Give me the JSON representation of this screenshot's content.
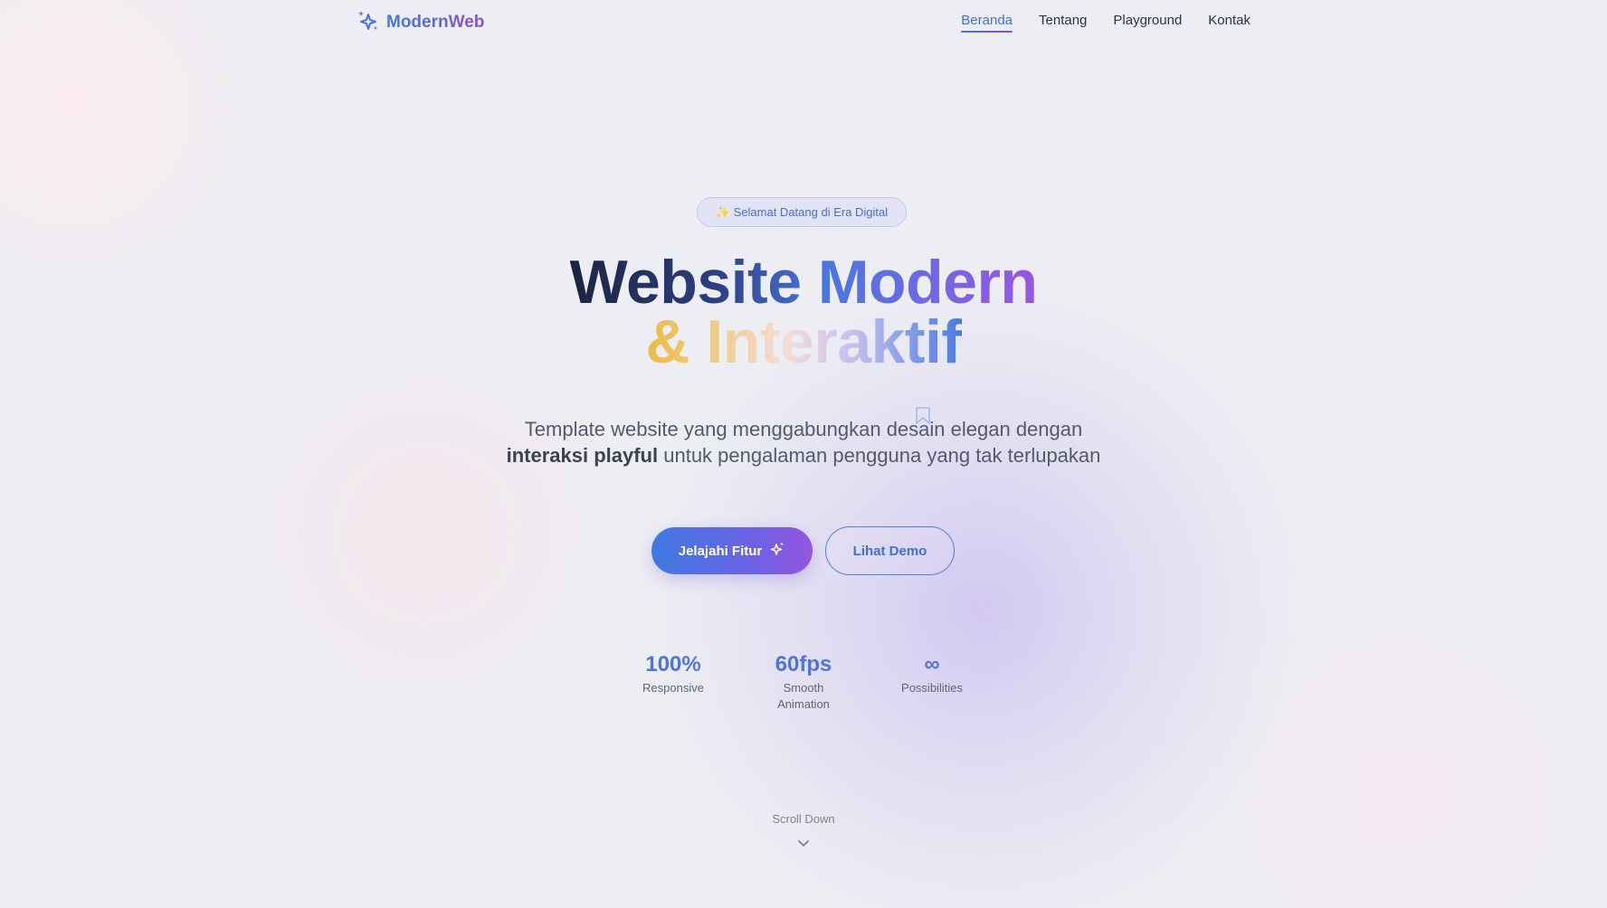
{
  "nav": {
    "logo_text": "ModernWeb",
    "logo_icon": "sparkles-icon",
    "links": [
      {
        "label": "Beranda",
        "active": true
      },
      {
        "label": "Tentang",
        "active": false
      },
      {
        "label": "Playground",
        "active": false
      },
      {
        "label": "Kontak",
        "active": false
      }
    ]
  },
  "hero": {
    "badge": "✨ Selamat Datang di Era Digital",
    "title_line1": "Website Modern",
    "title_line2": "& Interaktif",
    "subtitle_part1": "Template website yang menggabungkan desain elegan dengan",
    "subtitle_bold": "interaksi playful",
    "subtitle_part2": "untuk pengalaman pengguna yang tak terlupakan",
    "primary_button": "Jelajahi Fitur",
    "secondary_button": "Lihat Demo"
  },
  "stats": [
    {
      "value": "100%",
      "label": "Responsive"
    },
    {
      "value": "60fps",
      "label": "Smooth Animation"
    },
    {
      "value": "∞",
      "label": "Possibilities"
    }
  ],
  "scroll": {
    "label": "Scroll Down",
    "icon": "chevron-down-icon"
  },
  "colors": {
    "accent_blue": "#3f78e0",
    "accent_purple": "#9654e2",
    "accent_gold": "#ecba44",
    "text_dark": "#1b2440",
    "background": "#eceef3"
  }
}
